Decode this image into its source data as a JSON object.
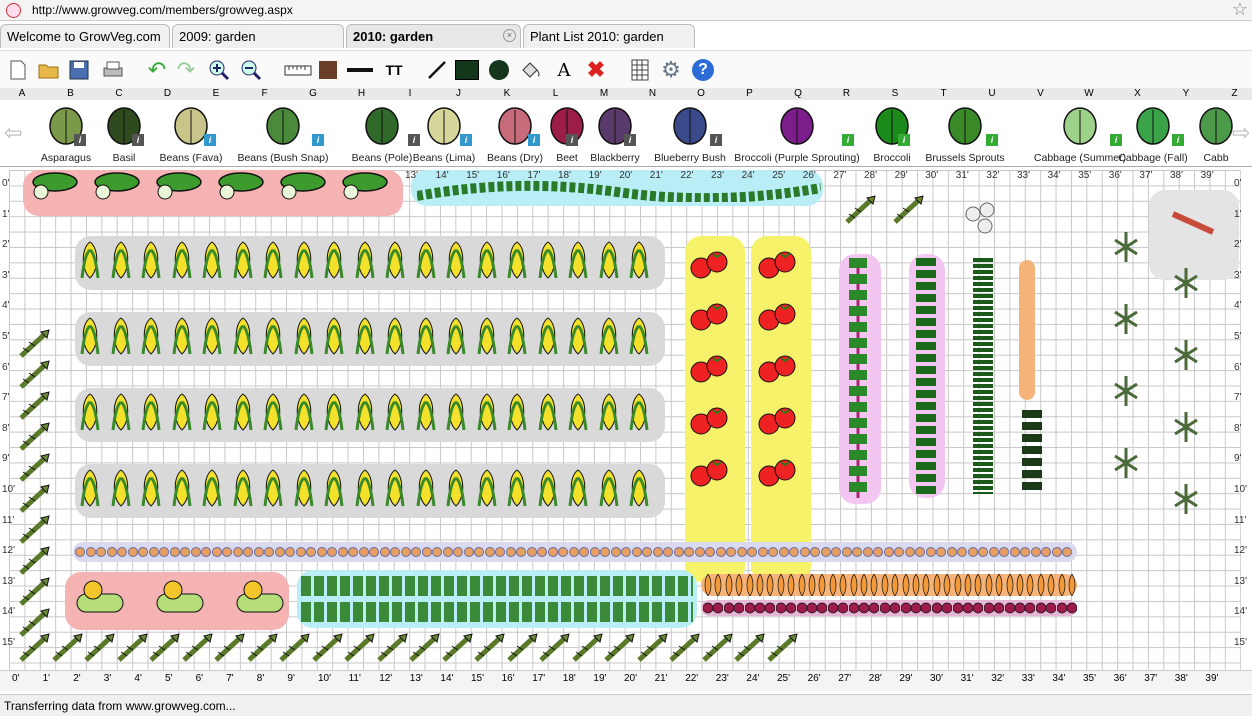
{
  "browser": {
    "url": "http://www.growveg.com/members/growveg.aspx"
  },
  "tabs": [
    {
      "label": "Welcome to GrowVeg.com"
    },
    {
      "label": "2009: garden"
    },
    {
      "label": "2010: garden"
    },
    {
      "label": "Plant List 2010: garden"
    }
  ],
  "toolbar": [
    "new-file",
    "open-folder",
    "save",
    "print",
    "undo",
    "redo",
    "zoom-in",
    "zoom-out",
    "ruler",
    "fill-color",
    "line-width",
    "text-size",
    "line-tool",
    "rectangle-tool",
    "circle-tool",
    "paint-bucket",
    "text-tool",
    "delete",
    "plant-list",
    "settings",
    "help"
  ],
  "columns": [
    "A",
    "B",
    "C",
    "D",
    "E",
    "F",
    "G",
    "H",
    "I",
    "J",
    "K",
    "L",
    "M",
    "N",
    "O",
    "P",
    "Q",
    "R",
    "S",
    "T",
    "U",
    "V",
    "W",
    "X",
    "Y",
    "Z"
  ],
  "palette": [
    {
      "label": "Asparagus",
      "info": "i"
    },
    {
      "label": "Basil",
      "info": "i"
    },
    {
      "label": "Beans (Fava)",
      "info": "i"
    },
    {
      "label": "Beans (Bush Snap)",
      "info": "i"
    },
    {
      "label": "Beans (Pole)",
      "info": "i"
    },
    {
      "label": "Beans (Lima)",
      "info": "i"
    },
    {
      "label": "Beans (Dry)",
      "info": "i"
    },
    {
      "label": "Beet",
      "info": "i"
    },
    {
      "label": "Blackberry",
      "info": "i"
    },
    {
      "label": "Blueberry Bush",
      "info": "i"
    },
    {
      "label": "Broccoli (Purple Sprouting)",
      "info": "i"
    },
    {
      "label": "Broccoli",
      "info": "i"
    },
    {
      "label": "Brussels Sprouts",
      "info": "i"
    },
    {
      "label": "Cabbage (Summer)",
      "info": "i"
    },
    {
      "label": "Cabbage (Fall)",
      "info": "i"
    },
    {
      "label": "Cabb",
      "info": ""
    }
  ],
  "top_ruler": [
    "13'",
    "14'",
    "15'",
    "16'",
    "17'",
    "18'",
    "19'",
    "20'",
    "21'",
    "22'",
    "23'",
    "24'",
    "25'",
    "26'",
    "27'",
    "28'",
    "29'",
    "30'",
    "31'",
    "32'",
    "33'",
    "34'",
    "35'",
    "36'",
    "37'",
    "38'",
    "39'"
  ],
  "left_ruler": [
    "0'",
    "1'",
    "2'",
    "3'",
    "4'",
    "5'",
    "6'",
    "7'",
    "8'",
    "9'",
    "10'",
    "11'",
    "12'",
    "13'",
    "14'",
    "15'"
  ],
  "bottom_ruler": [
    "0'",
    "1'",
    "2'",
    "3'",
    "4'",
    "5'",
    "6'",
    "7'",
    "8'",
    "9'",
    "10'",
    "11'",
    "12'",
    "13'",
    "14'",
    "15'",
    "16'",
    "17'",
    "18'",
    "19'",
    "20'",
    "21'",
    "22'",
    "23'",
    "24'",
    "25'",
    "26'",
    "27'",
    "28'",
    "29'",
    "30'",
    "31'",
    "32'",
    "33'",
    "34'",
    "35'",
    "36'",
    "37'",
    "38'",
    "39'"
  ],
  "status": {
    "text": "Transferring data from www.growveg.com..."
  },
  "colors": {
    "bed_red": "#f6b3b3",
    "bed_cyan": "#b9eef6",
    "bed_yellow": "#f6f36a",
    "bed_gray": "#d9d9d9",
    "bed_pink": "#f2c6f0",
    "bed_orange": "#f5b37a"
  }
}
